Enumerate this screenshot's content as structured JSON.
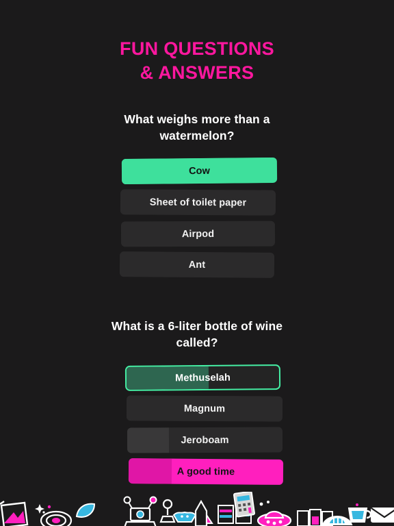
{
  "page": {
    "title_line_1": "FUN QUESTIONS",
    "title_line_2": "& ANSWERS",
    "background_color": "#1b1a1b",
    "accent_pink": "#ff179f",
    "accent_green": "#3ee09c"
  },
  "questions": [
    {
      "prompt": "What weighs more than a watermelon?",
      "options": [
        {
          "label": "Cow",
          "style": "green",
          "fill_percent": 96
        },
        {
          "label": "Sheet of toilet paper",
          "style": "plain",
          "fill_percent": 0
        },
        {
          "label": "Airpod",
          "style": "plain",
          "fill_percent": 0
        },
        {
          "label": "Ant",
          "style": "plain",
          "fill_percent": 0
        }
      ]
    },
    {
      "prompt": "What is a 6-liter bottle of wine called?",
      "options": [
        {
          "label": "Methuselah",
          "style": "green-outline",
          "fill_percent": 54
        },
        {
          "label": "Magnum",
          "style": "plain",
          "fill_percent": 0
        },
        {
          "label": "Jeroboam",
          "style": "plain",
          "fill_percent": 27
        },
        {
          "label": "A good time",
          "style": "pink",
          "fill_percent": 28
        }
      ]
    }
  ],
  "sticker_strip": {
    "icons": [
      "photo-frame-sticker",
      "spiral-galaxy-sticker",
      "blue-leaf-sticker",
      "laptop-sticker",
      "bat-sticker",
      "rocket-sticker",
      "lamp-sticker",
      "books-sticker",
      "ufo-sticker",
      "film-strip-sticker",
      "calculator-sticker",
      "eye-sticker",
      "cup-sticker",
      "envelope-sticker"
    ]
  }
}
